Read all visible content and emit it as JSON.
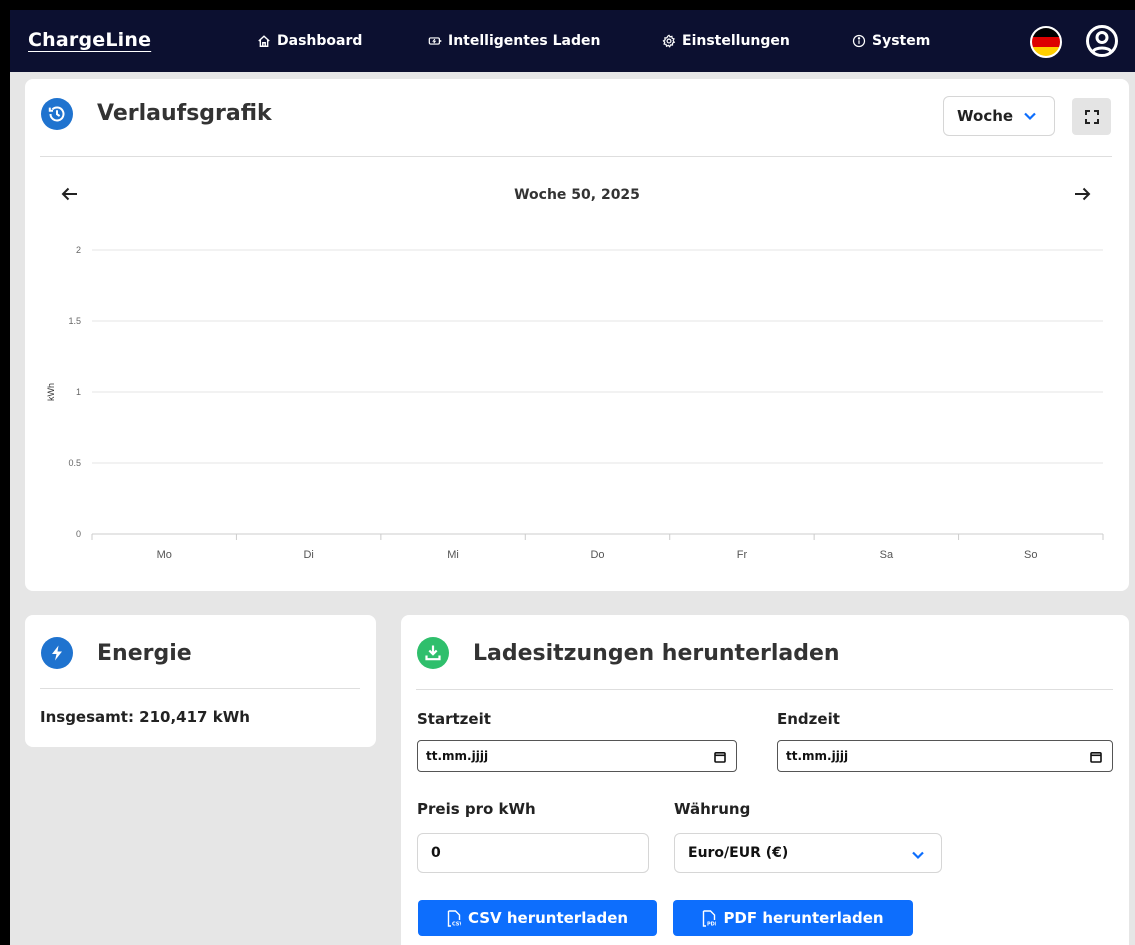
{
  "app": {
    "brand": "ChargeLine"
  },
  "nav": {
    "items": [
      {
        "label": "Dashboard",
        "icon": "home-icon"
      },
      {
        "label": "Intelligentes Laden",
        "icon": "battery-bolt-icon"
      },
      {
        "label": "Einstellungen",
        "icon": "gear-icon"
      },
      {
        "label": "System",
        "icon": "info-icon"
      }
    ],
    "language_flag": "germany-flag-icon",
    "profile_icon": "user-circle-icon"
  },
  "history": {
    "title": "Verlaufsgrafik",
    "range_value": "Woche",
    "week_label": "Woche 50, 2025"
  },
  "chart_data": {
    "type": "bar",
    "categories": [
      "Mo",
      "Di",
      "Mi",
      "Do",
      "Fr",
      "Sa",
      "So"
    ],
    "values": [
      0,
      0,
      0,
      0,
      0,
      0,
      0
    ],
    "ylabel": "kWh",
    "yticks": [
      "0",
      "0.5",
      "1",
      "1.5",
      "2"
    ],
    "ylim": [
      0,
      2
    ],
    "grid": true
  },
  "energy": {
    "title": "Energie",
    "total_text": "Insgesamt: 210,417 kWh"
  },
  "download": {
    "title": "Ladesitzungen herunterladen",
    "start_label": "Startzeit",
    "start_value": "tt.mm.jjjj",
    "end_label": "Endzeit",
    "end_value": "tt.mm.jjjj",
    "price_label": "Preis pro kWh",
    "price_value": "0",
    "currency_label": "Währung",
    "currency_value": "Euro/EUR (€)",
    "csv_button": "CSV herunterladen",
    "pdf_button": "PDF herunterladen"
  },
  "colors": {
    "navbar": "#0c1030",
    "accent_blue": "#0d6efd",
    "history_icon": "#1f73cf",
    "energy_icon": "#1f73cf",
    "download_icon": "#2fbf6c"
  }
}
